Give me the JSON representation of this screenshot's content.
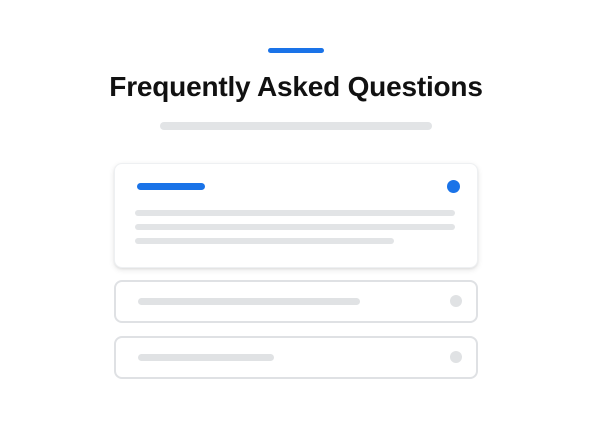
{
  "header": {
    "title": "Frequently Asked Questions",
    "accent_color": "#1a73e8"
  },
  "faq": {
    "items": [
      {
        "state": "expanded",
        "indicator_color": "#1a73e8"
      },
      {
        "state": "collapsed",
        "indicator_color": "#e0e2e4"
      },
      {
        "state": "collapsed",
        "indicator_color": "#e0e2e4"
      }
    ]
  },
  "colors": {
    "accent": "#1a73e8",
    "placeholder": "#e2e4e6",
    "border": "#dfe1e4",
    "title_text": "#111111"
  }
}
